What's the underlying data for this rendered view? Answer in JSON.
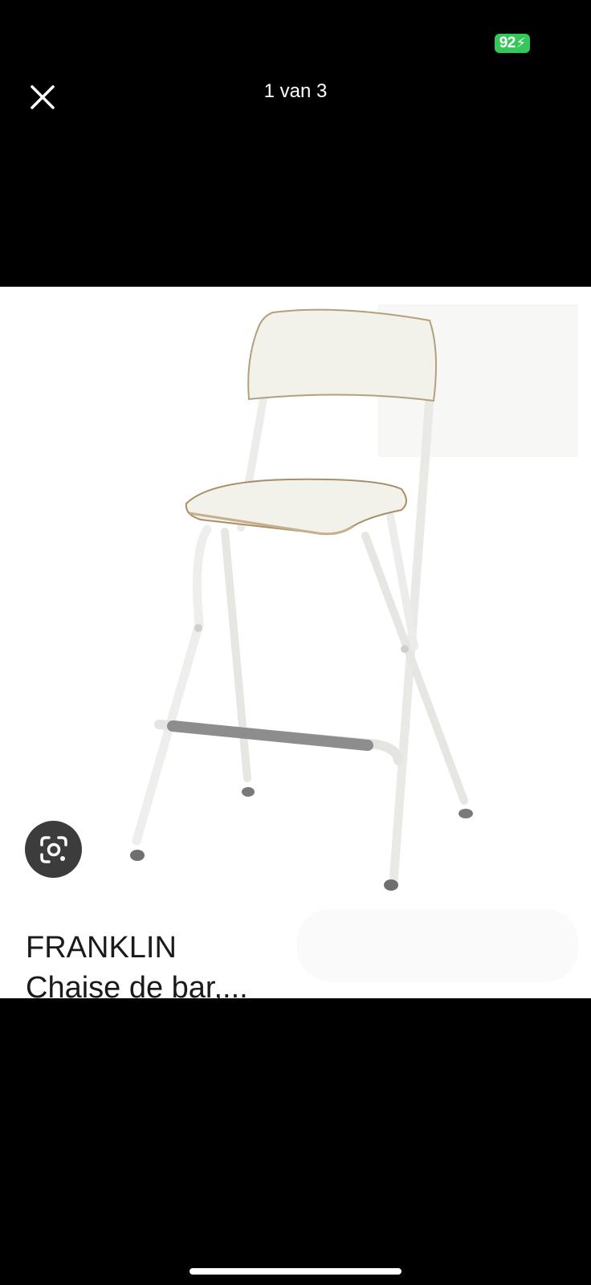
{
  "status_bar": {
    "battery_level": "92",
    "battery_color": "#34c759"
  },
  "viewer": {
    "page_counter": "1 van 3",
    "close_icon": "close-icon"
  },
  "image": {
    "caption_line1": "FRANKLIN",
    "caption_line2": "Chaise de bar,...",
    "lens_icon": "google-lens-icon"
  }
}
